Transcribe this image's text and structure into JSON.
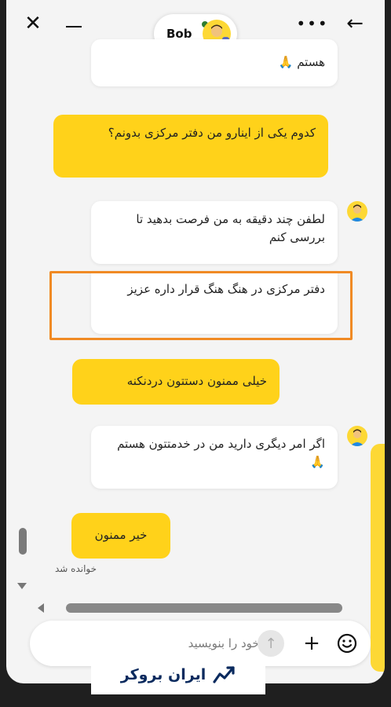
{
  "header": {
    "close_glyph": "✕",
    "more_glyph": "•••",
    "back_glyph": "←",
    "agent_name": "Bob"
  },
  "messages": [
    {
      "from": "agent",
      "text": "هستم 🙏"
    },
    {
      "from": "user",
      "text": "کدوم یکی از اینارو من دفتر مرکزی بدونم؟"
    },
    {
      "from": "agent",
      "text": "لطفن چند دقیقه به من فرصت بدهید تا بررسی کنم"
    },
    {
      "from": "agent",
      "text": "دفتر مرکزی در هنگ هنگ قرار داره عزیز"
    },
    {
      "from": "user",
      "text": "خیلی ممنون دستتون دردنکنه"
    },
    {
      "from": "agent",
      "text": "اگر امر دیگری دارید من در خدمتتون هستم 🙏"
    },
    {
      "from": "user",
      "text": "خیر ممنون"
    }
  ],
  "read_status": "خوانده شد",
  "composer": {
    "placeholder": "پیام خود را بنویسید",
    "send_glyph": "↑",
    "plus_glyph": "+"
  },
  "brand": {
    "name": "ایران بروکر"
  },
  "colors": {
    "accent": "#ffd21a",
    "highlight": "#f08a24",
    "brand": "#0a2a5e"
  }
}
